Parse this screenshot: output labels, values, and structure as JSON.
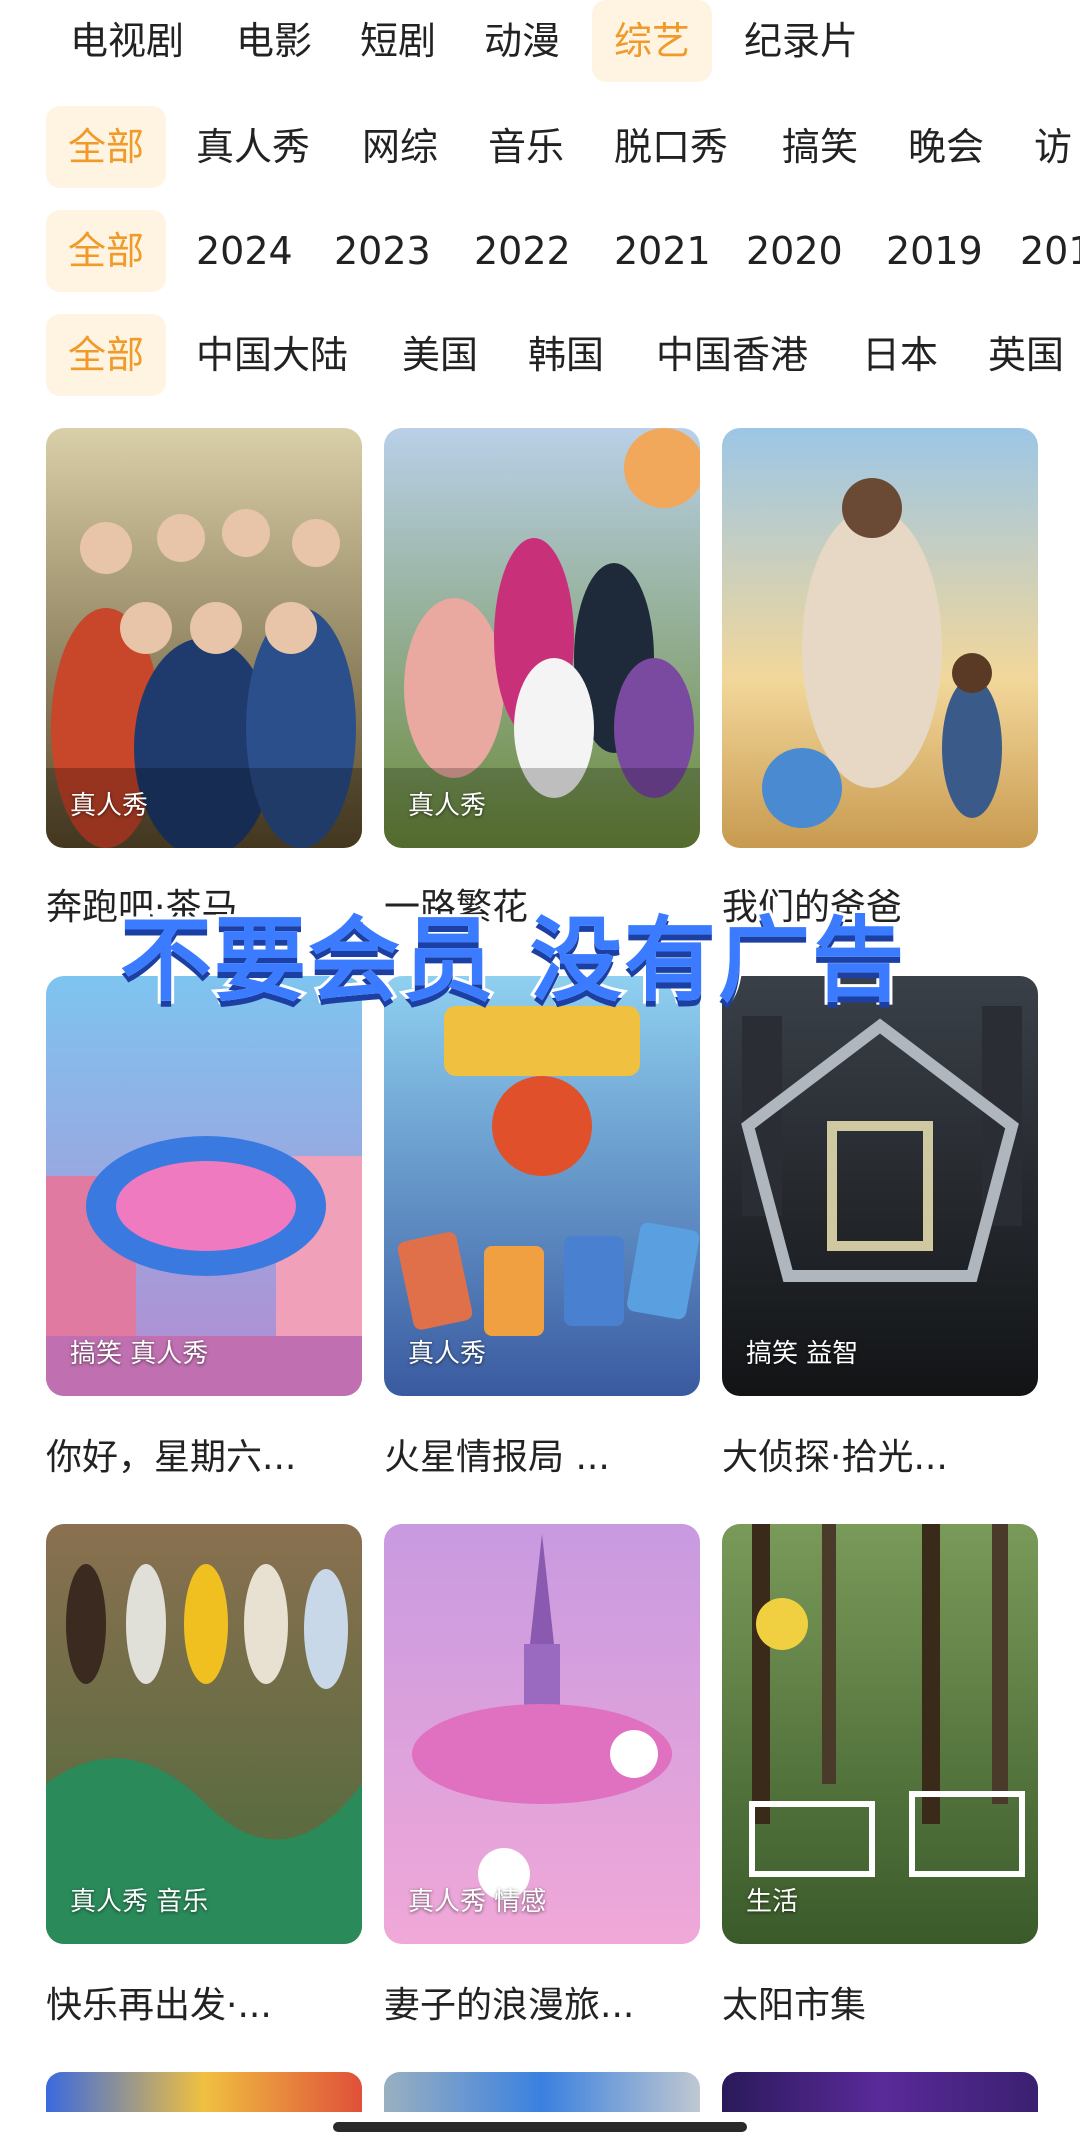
{
  "top_tabs": {
    "items": [
      "电视剧",
      "电影",
      "短剧",
      "动漫",
      "综艺",
      "纪录片"
    ],
    "active": "综艺"
  },
  "filter_type": {
    "items": [
      "全部",
      "真人秀",
      "网综",
      "音乐",
      "脱口秀",
      "搞笑",
      "晚会",
      "访"
    ],
    "active": "全部"
  },
  "filter_year": {
    "items": [
      "全部",
      "2024",
      "2023",
      "2022",
      "2021",
      "2020",
      "2019",
      "201"
    ],
    "active": "全部"
  },
  "filter_region": {
    "items": [
      "全部",
      "中国大陆",
      "美国",
      "韩国",
      "中国香港",
      "日本",
      "英国"
    ],
    "active": "全部"
  },
  "banner_text": "不要会员 没有广告",
  "shows": [
    {
      "title": "奔跑吧·茶马",
      "tag": "真人秀"
    },
    {
      "title": "一路繁花",
      "tag": "真人秀"
    },
    {
      "title": "我们的爸爸",
      "tag": ""
    },
    {
      "title": "你好，星期六...",
      "tag": "搞笑 真人秀"
    },
    {
      "title": "火星情报局 ...",
      "tag": "真人秀"
    },
    {
      "title": "大侦探·拾光...",
      "tag": "搞笑 益智"
    },
    {
      "title": "快乐再出发·...",
      "tag": "真人秀 音乐"
    },
    {
      "title": "妻子的浪漫旅...",
      "tag": "真人秀 情感"
    },
    {
      "title": "太阳市集",
      "tag": "生活"
    }
  ],
  "colors": {
    "accent": "#f09a2a",
    "accent_bg": "#fff3e2"
  }
}
